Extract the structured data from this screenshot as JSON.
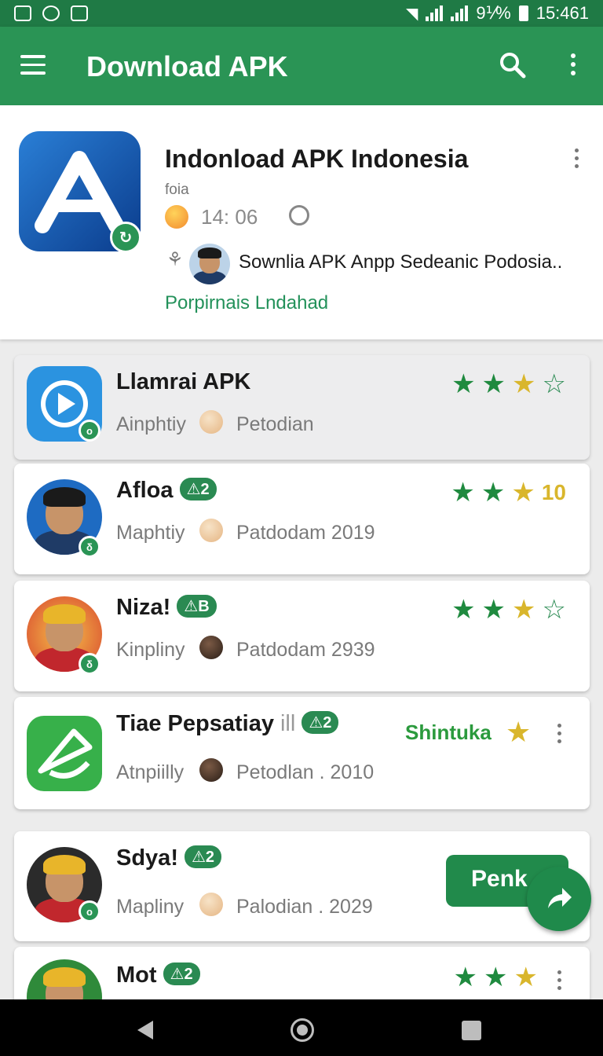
{
  "status_bar": {
    "battery": "9⅟%",
    "time": "15:461"
  },
  "app_bar": {
    "title": "Download APK"
  },
  "header": {
    "title": "Indonload APK Indonesia",
    "subtitle": "foia",
    "time": "14: 06",
    "description": "Sownlia APK Anpp Sedeanic Podosia..",
    "link": "Porpirnais Lndahad"
  },
  "items": [
    {
      "title": "Llamrai APK",
      "sub": "Ainphtiy",
      "date": "Petodian"
    },
    {
      "title": "Afloa",
      "tag": "2",
      "sub": "Maphtiy",
      "date": "Patdodam 2019",
      "rating_num": "10"
    },
    {
      "title": "Niza!",
      "tag": "B",
      "sub": "Kinpliny",
      "date": "Patdodam 2939"
    },
    {
      "title": "Tiae Pepsatiay",
      "tag": "2",
      "sub": "Atnpiilly",
      "date": "Petodlan . 2010",
      "badge": "Shintuka"
    },
    {
      "title": "Sdya!",
      "tag": "2",
      "sub": "Mapliny",
      "date": "Palodian . 2029",
      "button": "Penk"
    },
    {
      "title": "Mot",
      "tag": "2"
    }
  ]
}
